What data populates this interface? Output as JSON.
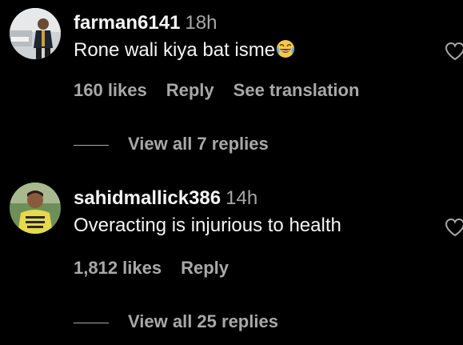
{
  "comments": [
    {
      "username": "farman6141",
      "time": "18h",
      "text": "Rone wali kiya bat isme",
      "emoji": "face-with-tears-of-joy",
      "likes": "160 likes",
      "reply_label": "Reply",
      "translation_label": "See translation",
      "view_replies": "View all 7 replies"
    },
    {
      "username": "sahidmallick386",
      "time": "14h",
      "text": "Overacting is injurious to health",
      "likes": "1,812 likes",
      "reply_label": "Reply",
      "view_replies": "View all 25 replies"
    }
  ],
  "colors": {
    "background": "#000000",
    "primary_text": "#f5f5f5",
    "secondary_text": "#a8a8a8"
  },
  "icons": {
    "like": "heart-outline-icon"
  }
}
